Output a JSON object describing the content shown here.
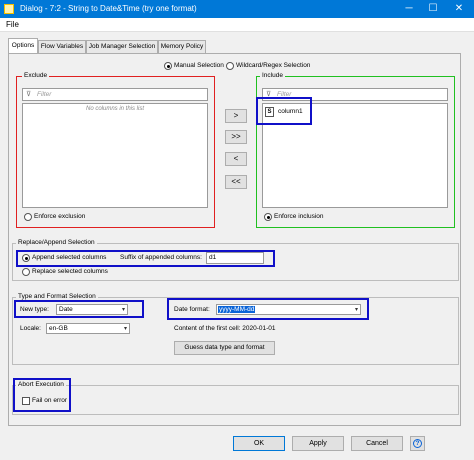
{
  "window": {
    "title": "Dialog - 7:2 - String to Date&Time (try one format)",
    "menu": [
      "File"
    ]
  },
  "tabs": [
    "Options",
    "Flow Variables",
    "Job Manager Selection",
    "Memory Policy"
  ],
  "column_filter": {
    "mode_manual": "Manual Selection",
    "mode_wildcard": "Wildcard/Regex Selection",
    "exclude_title": "Exclude",
    "include_title": "Include",
    "exclude_filter_placeholder": "Filter",
    "include_filter_placeholder": "Filter",
    "exclude_empty": "No columns in this list",
    "include_items": [
      {
        "type_badge": "S",
        "name": "column1"
      }
    ],
    "enforce_exclusion": "Enforce exclusion",
    "enforce_inclusion": "Enforce inclusion",
    "move_buttons": {
      "add": ">",
      "add_all": ">>",
      "remove": "<",
      "remove_all": "<<"
    }
  },
  "replace_append": {
    "title": "Replace/Append Selection",
    "append_label": "Append selected columns",
    "suffix_label": "Suffix of appended columns:",
    "suffix_value": "d1",
    "replace_label": "Replace selected columns"
  },
  "type_format": {
    "title": "Type and Format Selection",
    "new_type_label": "New type:",
    "new_type_value": "Date",
    "date_format_label": "Date format:",
    "date_format_value": "yyyy-MM-dd",
    "locale_label": "Locale:",
    "locale_value": "en-GB",
    "first_cell_text": "Content of the first cell: 2020-01-01",
    "guess_button": "Guess data type and format"
  },
  "abort": {
    "title": "Abort Execution",
    "fail_label": "Fail on error"
  },
  "footer": {
    "ok": "OK",
    "apply": "Apply",
    "cancel": "Cancel",
    "help": "?"
  },
  "icons": {
    "window_controls": [
      "minimize-icon",
      "maximize-icon",
      "close-icon"
    ],
    "min": "─",
    "max": "☐",
    "close": "✕",
    "filter": "⊽",
    "dropdown": "▾"
  },
  "colors": {
    "exclude_border": "#e02020",
    "include_border": "#20c020",
    "highlight": "#1010c8",
    "titlebar": "#0078d7",
    "selection": "#0a64d8"
  }
}
